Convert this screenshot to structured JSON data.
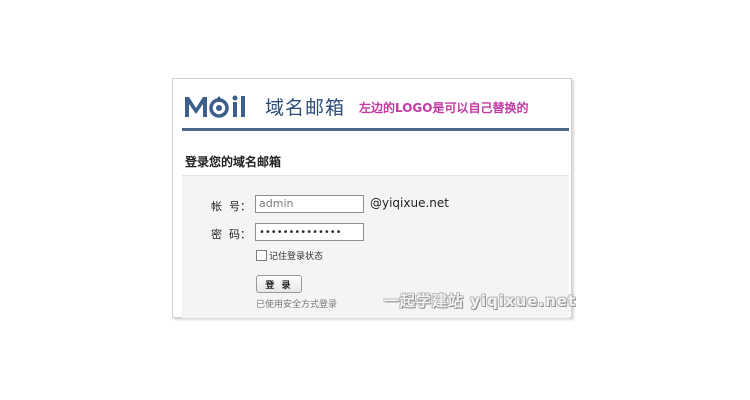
{
  "header": {
    "logo_text": "MOil",
    "brand": "域名邮箱",
    "note": "左边的LOGO是可以自己替换的"
  },
  "form": {
    "title": "登录您的域名邮箱",
    "account_label": "帐  号：",
    "account_value": "admin",
    "domain_suffix": "@yiqixue.net",
    "password_label": "密  码：",
    "password_value": "••••••••••••••",
    "remember_label": "记住登录状态",
    "remember_checked": false,
    "login_button": "登 录",
    "secure_note": "已使用安全方式登录"
  },
  "watermark": "一起学建站 yiqixue.net",
  "colors": {
    "brand_blue": "#2c4d7a",
    "note_magenta": "#c33aa4",
    "rule": "#4a6888"
  }
}
